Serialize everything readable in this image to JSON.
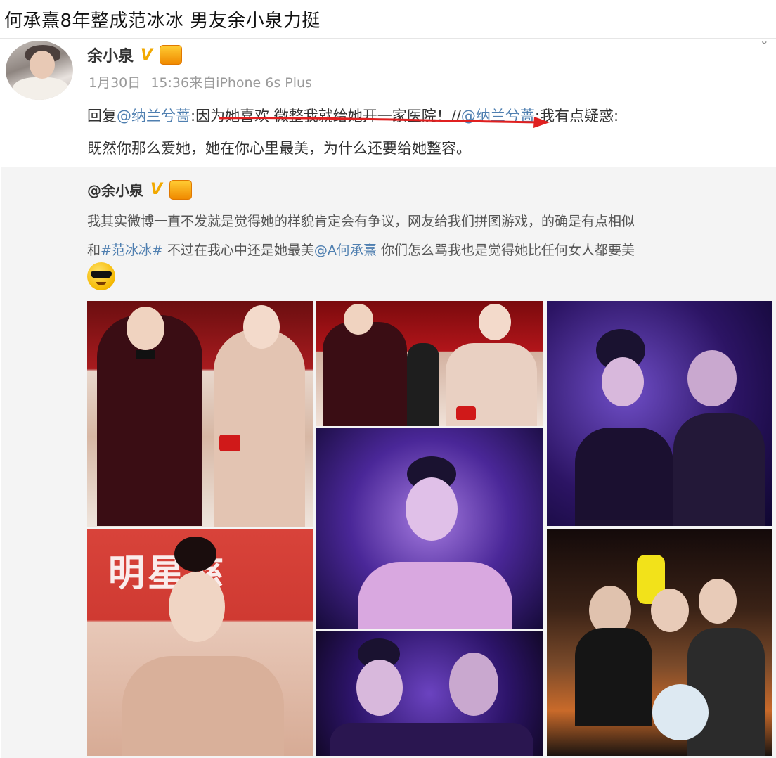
{
  "headline": {
    "title": "何承熹8年整成范冰冰 男友余小泉力挺"
  },
  "post": {
    "username": "余小泉",
    "verified_badge": "V",
    "level_badge": "",
    "date": "1月30日",
    "time": "15:36",
    "source": "来自iPhone 6s Plus",
    "reply": {
      "prefix": "回复",
      "mention1": "@纳兰兮蔷",
      "text1": ":因为她喜欢 微整我就给她开一家医院！//",
      "mention2": "@纳兰兮蔷",
      "text2": ":我有点疑惑:",
      "line2": "既然你那么爱她，她在你心里最美，为什么还要给她整容。"
    }
  },
  "quoted": {
    "username": "@余小泉",
    "text_line1": "我其实微博一直不发就是觉得她的样貌肯定会有争议，网友给我们拼图游戏，的确是有点相似",
    "prefix2": "和",
    "hashtag": "#范冰冰#",
    "text2": " 不过在我心中还是她最美",
    "mention": "@A何承熹",
    "text3": " 你们怎么骂我也是觉得她比任何女人都要美",
    "emoji": "cool-sunglasses-emoji",
    "photo_caption_fragment": "明星慈"
  },
  "colors": {
    "link": "#4f7fb0",
    "annotation_arrow": "#e02020",
    "quoted_bg": "#f4f4f4"
  }
}
